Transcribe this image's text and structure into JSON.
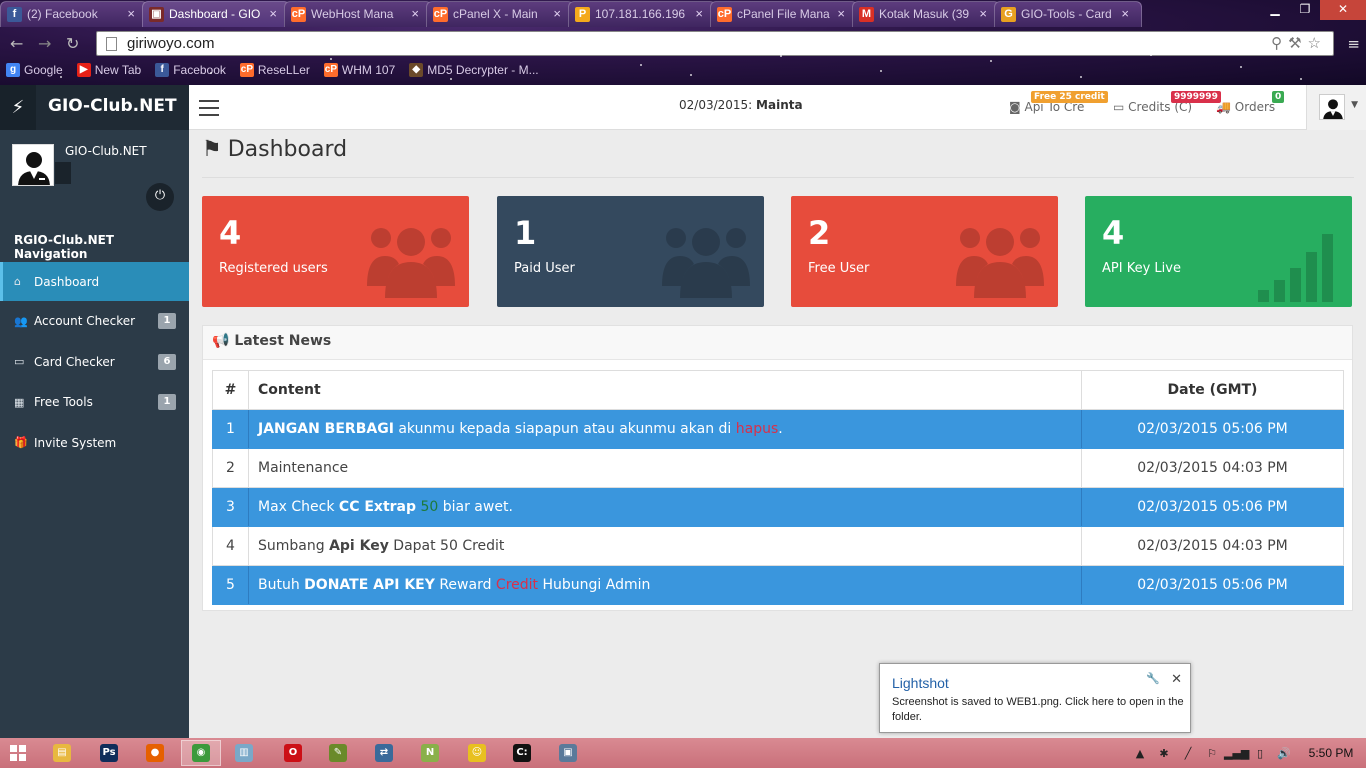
{
  "browser": {
    "tabs": [
      {
        "title": "(2) Facebook",
        "favicon": "facebook-icon",
        "color": "#3b5998",
        "glyph": "f"
      },
      {
        "title": "Dashboard - GIO",
        "favicon": "site-icon",
        "color": "#7a2a2a",
        "glyph": "▣",
        "active": true
      },
      {
        "title": "WebHost Mana",
        "favicon": "cpanel-icon",
        "color": "#ff6c2c",
        "glyph": "cP"
      },
      {
        "title": "cPanel X - Main",
        "favicon": "cpanel-icon",
        "color": "#ff6c2c",
        "glyph": "cP"
      },
      {
        "title": "107.181.166.196",
        "favicon": "pma-icon",
        "color": "#f4a91c",
        "glyph": "P"
      },
      {
        "title": "cPanel File Mana",
        "favicon": "cpanel-icon",
        "color": "#ff6c2c",
        "glyph": "cP"
      },
      {
        "title": "Kotak Masuk (39",
        "favicon": "gmail-icon",
        "color": "#d93025",
        "glyph": "M"
      },
      {
        "title": "GIO-Tools - Card",
        "favicon": "g-icon",
        "color": "#e8a020",
        "glyph": "G"
      }
    ],
    "url": "giriwoyo.com",
    "bookmarks": [
      {
        "label": "Google",
        "color": "#4285f4",
        "glyph": "g"
      },
      {
        "label": "New Tab",
        "color": "#e62117",
        "glyph": "▶"
      },
      {
        "label": "Facebook",
        "color": "#3b5998",
        "glyph": "f"
      },
      {
        "label": "ReseLLer",
        "color": "#ff6c2c",
        "glyph": "cP"
      },
      {
        "label": "WHM 107",
        "color": "#ff6c2c",
        "glyph": "cP"
      },
      {
        "label": "MD5 Decrypter - M...",
        "color": "#6b4a2a",
        "glyph": "◆"
      }
    ]
  },
  "app": {
    "brand": "GIO-Club.NET",
    "user_name": "GIO-Club.NET",
    "nav_title": "RGIO-Club.NET Navigation",
    "menu": [
      {
        "label": "Dashboard",
        "icon": "home-icon",
        "glyph": "⌂",
        "badge": "",
        "active": true
      },
      {
        "label": "Account Checker",
        "icon": "users-icon",
        "glyph": "👥",
        "badge": "1"
      },
      {
        "label": "Card Checker",
        "icon": "credit-card-icon",
        "glyph": "▭",
        "badge": "6"
      },
      {
        "label": "Free Tools",
        "icon": "grid-icon",
        "glyph": "▦",
        "badge": "1"
      },
      {
        "label": "Invite System",
        "icon": "gift-icon",
        "glyph": "🎁",
        "badge": ""
      }
    ],
    "topbar": {
      "date": "02/03/2015:",
      "status": "Mainta",
      "api": {
        "label": "Api To Cre",
        "badge": "Free 25 credit",
        "badge_color": "#f0a030"
      },
      "credits": {
        "label": "Credits (C)",
        "badge": "9999999",
        "badge_color": "#d9304a"
      },
      "orders": {
        "label": "Orders",
        "badge": "0",
        "badge_color": "#3aaa52"
      }
    },
    "page_title": "Dashboard",
    "stats": [
      {
        "value": "4",
        "label": "Registered users",
        "color": "#e74c3c",
        "icon": "users-icon"
      },
      {
        "value": "1",
        "label": "Paid User",
        "color": "#34495e",
        "icon": "users-icon"
      },
      {
        "value": "2",
        "label": "Free User",
        "color": "#e74c3c",
        "icon": "users-icon"
      },
      {
        "value": "4",
        "label": "API Key Live",
        "color": "#27ae60",
        "icon": "signal-icon"
      }
    ],
    "news": {
      "title": "Latest News",
      "headers": [
        "#",
        "Content",
        "Date (GMT)"
      ],
      "rows": [
        {
          "num": "1",
          "parts": [
            {
              "t": "JANGAN BERBAGI",
              "s": "b"
            },
            {
              "t": " akunmu kepada siapapun atau akunmu akan di "
            },
            {
              "t": "hapus",
              "s": "red"
            },
            {
              "t": "."
            }
          ],
          "date": "02/03/2015 05:06 PM",
          "hl": true
        },
        {
          "num": "2",
          "parts": [
            {
              "t": "Maintenance"
            }
          ],
          "date": "02/03/2015 04:03 PM",
          "hl": false
        },
        {
          "num": "3",
          "parts": [
            {
              "t": "Max Check "
            },
            {
              "t": "CC Extrap",
              "s": "b"
            },
            {
              "t": " "
            },
            {
              "t": "50",
              "s": "grn"
            },
            {
              "t": " biar awet."
            }
          ],
          "date": "02/03/2015 05:06 PM",
          "hl": true
        },
        {
          "num": "4",
          "parts": [
            {
              "t": "Sumbang "
            },
            {
              "t": "Api Key",
              "s": "b"
            },
            {
              "t": " Dapat 50 Credit"
            }
          ],
          "date": "02/03/2015 04:03 PM",
          "hl": false
        },
        {
          "num": "5",
          "parts": [
            {
              "t": "Butuh "
            },
            {
              "t": "DONATE API KEY",
              "s": "b"
            },
            {
              "t": " Reward "
            },
            {
              "t": "Credit",
              "s": "red"
            },
            {
              "t": " Hubungi Admin"
            }
          ],
          "date": "02/03/2015 05:06 PM",
          "hl": true
        }
      ]
    }
  },
  "lightshot": {
    "title": "Lightshot",
    "message": "Screenshot is saved to WEB1.png. Click here to open in the folder."
  },
  "taskbar": {
    "apps": [
      {
        "name": "explorer-icon",
        "color": "#e8b840",
        "glyph": "▤"
      },
      {
        "name": "photoshop-icon",
        "color": "#0f2d5a",
        "glyph": "Ps"
      },
      {
        "name": "firefox-icon",
        "color": "#e66000",
        "glyph": "●"
      },
      {
        "name": "chrome-icon",
        "color": "#3c9a3c",
        "glyph": "◉",
        "active": true
      },
      {
        "name": "notepad-icon",
        "color": "#7aa8c8",
        "glyph": "▥"
      },
      {
        "name": "opera-icon",
        "color": "#cc0f16",
        "glyph": "O"
      },
      {
        "name": "tool-icon",
        "color": "#6a8a2a",
        "glyph": "✎"
      },
      {
        "name": "network-icon",
        "color": "#3a6a9a",
        "glyph": "⇄"
      },
      {
        "name": "notepadpp-icon",
        "color": "#8ab04a",
        "glyph": "N"
      },
      {
        "name": "messenger-icon",
        "color": "#e8c020",
        "glyph": "☺"
      },
      {
        "name": "cmd-icon",
        "color": "#111111",
        "glyph": "C:"
      },
      {
        "name": "remote-icon",
        "color": "#5a7a9a",
        "glyph": "▣"
      }
    ],
    "clock": "5:50 PM"
  }
}
